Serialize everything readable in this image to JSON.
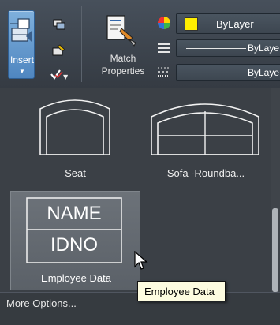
{
  "ribbon": {
    "insert_label": "Insert",
    "match_properties_line1": "Match",
    "match_properties_line2": "Properties",
    "layer_color_label": "ByLayer",
    "linetype_label": "ByLaye",
    "lineweight_label": "ByLaye",
    "layer_color_hex": "#ffee00"
  },
  "palette": {
    "blocks": [
      {
        "label": "Seat",
        "icon": "seat-block-icon"
      },
      {
        "label": "Sofa -Roundba...",
        "icon": "sofa-block-icon"
      },
      {
        "label": "Employee Data",
        "icon": "employee-data-block-icon",
        "name_text": "NAME",
        "id_text": "IDNO"
      }
    ],
    "more_options_label": "More Options..."
  },
  "tooltip": {
    "text": "Employee Data"
  }
}
